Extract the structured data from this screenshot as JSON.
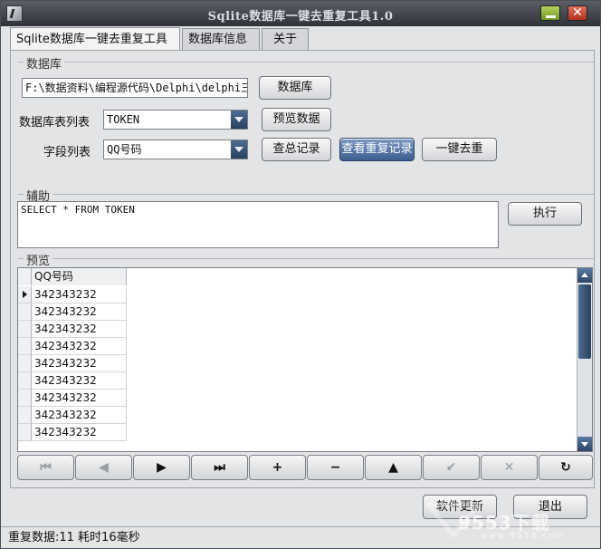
{
  "window": {
    "title": "Sqlite数据库一键去重复工具1.0",
    "close_glyph": "✕"
  },
  "tabs": [
    {
      "label": "Sqlite数据库一键去重复工具"
    },
    {
      "label": "数据库信息"
    },
    {
      "label": "关于"
    }
  ],
  "database_group": {
    "title": "数据库",
    "path_value": "F:\\数据资料\\编程源代码\\Delphi\\delphi三",
    "db_button": "数据库",
    "table_label": "数据库表列表",
    "table_value": "TOKEN",
    "preview_button": "预览数据",
    "field_label": "字段列表",
    "field_value": "QQ号码",
    "total_button": "查总记录",
    "view_dup_button": "查看重复记录",
    "dedupe_button": "一键去重"
  },
  "helper_group": {
    "title": "辅助",
    "sql_value": "SELECT * FROM TOKEN",
    "exec_button": "执行"
  },
  "preview_group": {
    "title": "预览",
    "column_header": "QQ号码",
    "rows": [
      "342343232",
      "342343232",
      "342343232",
      "342343232",
      "342343232",
      "342343232",
      "342343232",
      "342343232",
      "342343232"
    ]
  },
  "navigator": [
    "⏮",
    "◀",
    "▶",
    "⏭",
    "+",
    "−",
    "▲",
    "✔",
    "✕",
    "↻"
  ],
  "bottom": {
    "update_button": "软件更新",
    "exit_button": "退出"
  },
  "status": {
    "text": "重复数据:11 耗时16毫秒"
  },
  "watermark": {
    "text": "9553下载",
    "url": "www.9553.com"
  },
  "colors": {
    "titlebar": "#2f3338",
    "accent": "#3d5f8f",
    "panel": "#e3e4e6"
  }
}
